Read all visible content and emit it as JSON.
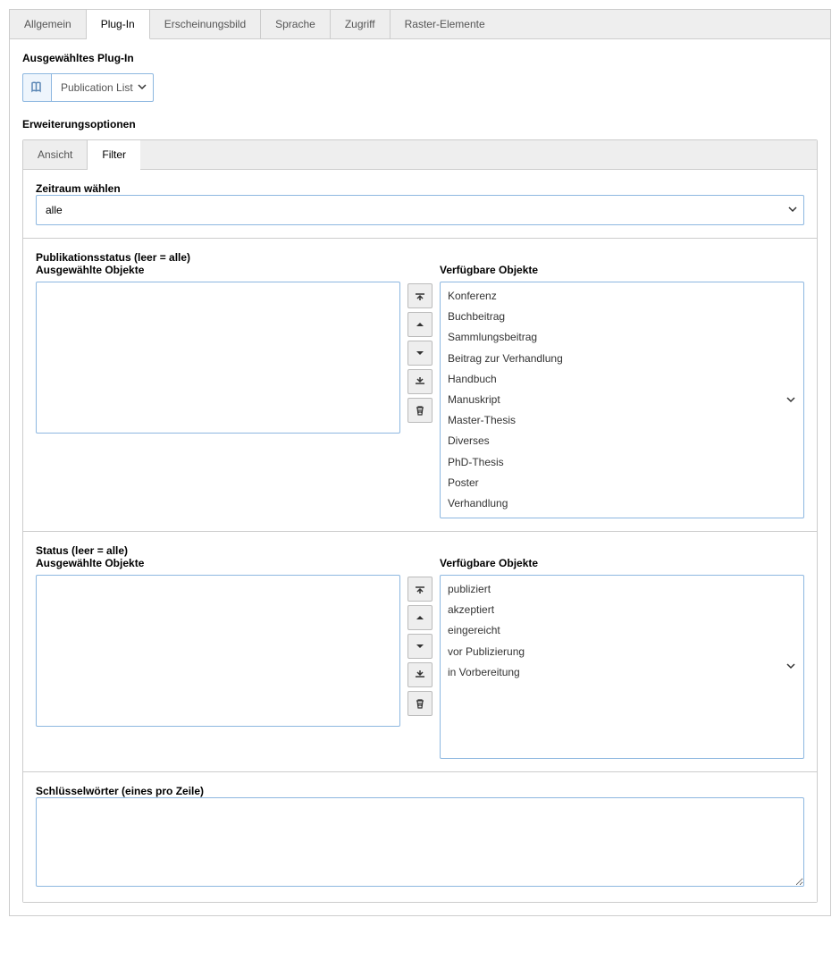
{
  "main_tabs": {
    "items": [
      {
        "label": "Allgemein"
      },
      {
        "label": "Plug-In"
      },
      {
        "label": "Erscheinungsbild"
      },
      {
        "label": "Sprache"
      },
      {
        "label": "Zugriff"
      },
      {
        "label": "Raster-Elemente"
      }
    ]
  },
  "plugin_block": {
    "title": "Ausgewähltes Plug-In",
    "selected": "Publication List"
  },
  "ext_title": "Erweiterungsoptionen",
  "inner_tabs": {
    "items": [
      {
        "label": "Ansicht"
      },
      {
        "label": "Filter"
      }
    ]
  },
  "period": {
    "label": "Zeitraum wählen",
    "value": "alle"
  },
  "pubstatus": {
    "title": "Publikationsstatus (leer = alle)",
    "selected_label": "Ausgewählte Objekte",
    "available_label": "Verfügbare Objekte",
    "available": [
      "Konferenz",
      "Buchbeitrag",
      "Sammlungsbeitrag",
      "Beitrag zur Verhandlung",
      "Handbuch",
      "Manuskript",
      "Master-Thesis",
      "Diverses",
      "PhD-Thesis",
      "Poster",
      "Verhandlung"
    ]
  },
  "status": {
    "title": "Status (leer = alle)",
    "selected_label": "Ausgewählte Objekte",
    "available_label": "Verfügbare Objekte",
    "available": [
      "publiziert",
      "akzeptiert",
      "eingereicht",
      "vor Publizierung",
      "in Vorbereitung"
    ]
  },
  "keywords": {
    "title": "Schlüsselwörter (eines pro Zeile)"
  }
}
